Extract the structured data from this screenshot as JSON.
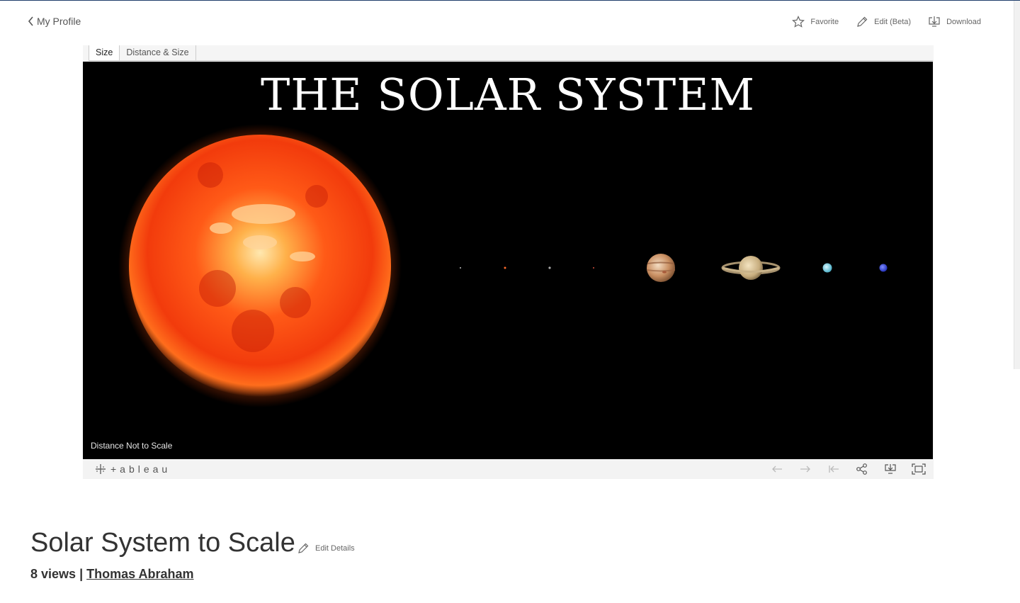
{
  "nav": {
    "back_label": "My Profile"
  },
  "actions": {
    "favorite": "Favorite",
    "edit": "Edit (Beta)",
    "download": "Download"
  },
  "tabs": [
    {
      "label": "Size",
      "active": true
    },
    {
      "label": "Distance & Size",
      "active": false
    }
  ],
  "viz": {
    "title": "THE SOLAR SYSTEM",
    "note": "Distance Not to Scale",
    "bodies": [
      "Sun",
      "Mercury",
      "Mars",
      "Venus",
      "Earth",
      "Jupiter",
      "Saturn",
      "Uranus",
      "Neptune"
    ]
  },
  "toolbar": {
    "brand": "+ableau",
    "buttons": [
      "undo-icon",
      "redo-icon",
      "revert-icon",
      "share-icon",
      "download-icon",
      "fullscreen-icon"
    ]
  },
  "workbook": {
    "title": "Solar System to Scale",
    "edit_label": "Edit Details",
    "views": "8 views",
    "separator": "|",
    "author": "Thomas Abraham"
  },
  "colors": {
    "topline": "#1f3d6b",
    "canvas": "#000000",
    "sun": "#ff4a12"
  }
}
